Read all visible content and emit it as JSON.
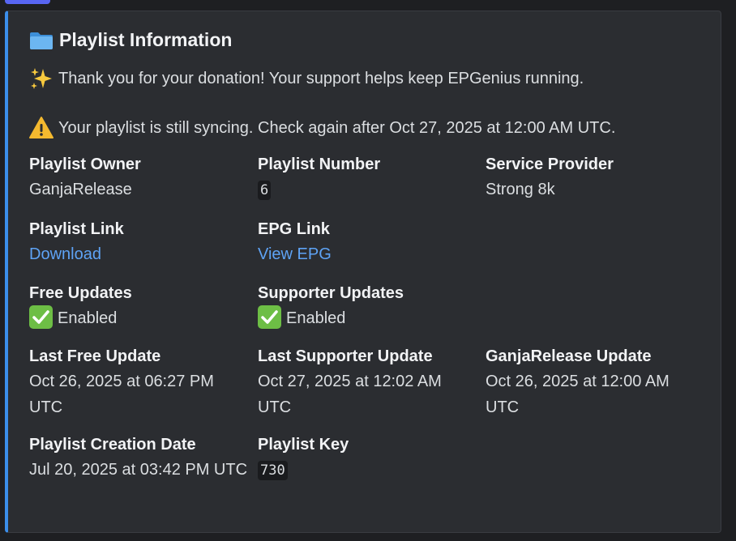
{
  "embed": {
    "title": "Playlist Information",
    "donation_text": "Thank you for your donation! Your support helps keep EPGenius running.",
    "syncing_text": "Your playlist is still syncing. Check again after Oct 27, 2025 at 12:00 AM UTC.",
    "accent_color": "#3b8eea"
  },
  "fields": {
    "owner": {
      "name": "Playlist Owner",
      "value": "GanjaRelease"
    },
    "number": {
      "name": "Playlist Number",
      "value": "6"
    },
    "provider": {
      "name": "Service Provider",
      "value": "Strong 8k"
    },
    "link": {
      "name": "Playlist Link",
      "value": "Download"
    },
    "epg": {
      "name": "EPG Link",
      "value": "View EPG"
    },
    "free_updates": {
      "name": "Free Updates",
      "value": "Enabled"
    },
    "supporter_updates": {
      "name": "Supporter Updates",
      "value": "Enabled"
    },
    "last_free": {
      "name": "Last Free Update",
      "value": "Oct 26, 2025 at 06:27 PM UTC"
    },
    "last_supporter": {
      "name": "Last Supporter Update",
      "value": "Oct 27, 2025 at 12:02 AM UTC"
    },
    "ganja_update": {
      "name": "GanjaRelease Update",
      "value": "Oct 26, 2025 at 12:00 AM UTC"
    },
    "creation": {
      "name": "Playlist Creation Date",
      "value": "Jul 20, 2025 at 03:42 PM UTC"
    },
    "key": {
      "name": "Playlist Key",
      "value": "730"
    }
  },
  "icons": {
    "title": "folder-icon",
    "donation": "sparkles-icon",
    "syncing": "warning-icon",
    "enabled": "check-mark-icon"
  }
}
